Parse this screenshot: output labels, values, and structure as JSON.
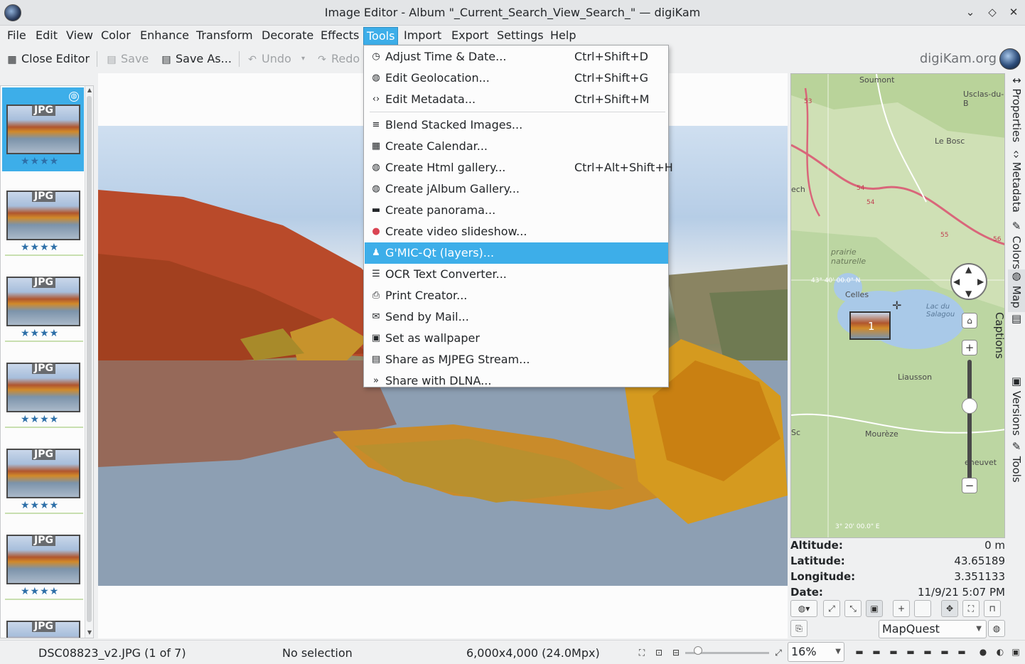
{
  "window": {
    "title": "Image Editor - Album \"_Current_Search_View_Search_\" — digiKam",
    "controls": [
      "⌄",
      "◇",
      "✕"
    ]
  },
  "menubar": [
    "File",
    "Edit",
    "View",
    "Color",
    "Enhance",
    "Transform",
    "Decorate",
    "Effects",
    "Tools",
    "Import",
    "Export",
    "Settings",
    "Help"
  ],
  "toolbar": {
    "close_editor": "Close Editor",
    "save": "Save",
    "save_as": "Save As...",
    "undo": "Undo",
    "redo": "Redo",
    "brand": "digiKam.org"
  },
  "tools_menu": [
    {
      "icon": "clock-icon",
      "glyph": "◷",
      "label": "Adjust Time & Date...",
      "shortcut": "Ctrl+Shift+D"
    },
    {
      "icon": "globe-icon",
      "glyph": "◍",
      "label": "Edit Geolocation...",
      "shortcut": "Ctrl+Shift+G"
    },
    {
      "icon": "code-icon",
      "glyph": "‹›",
      "label": "Edit Metadata...",
      "shortcut": "Ctrl+Shift+M"
    },
    {
      "separator": true
    },
    {
      "icon": "stack-icon",
      "glyph": "≡",
      "label": "Blend Stacked Images...",
      "shortcut": ""
    },
    {
      "icon": "calendar-icon",
      "glyph": "▦",
      "label": "Create Calendar...",
      "shortcut": ""
    },
    {
      "icon": "web-icon",
      "glyph": "◍",
      "label": "Create Html gallery...",
      "shortcut": "Ctrl+Alt+Shift+H"
    },
    {
      "icon": "web-icon",
      "glyph": "◍",
      "label": "Create jAlbum Gallery...",
      "shortcut": ""
    },
    {
      "icon": "panorama-icon",
      "glyph": "▬",
      "label": "Create panorama...",
      "shortcut": ""
    },
    {
      "icon": "record-icon",
      "glyph": "●",
      "label": "Create video slideshow...",
      "shortcut": ""
    },
    {
      "icon": "gmic-icon",
      "glyph": "♟",
      "label": "G'MIC-Qt (layers)...",
      "shortcut": "",
      "highlight": true
    },
    {
      "icon": "text-icon",
      "glyph": "☰",
      "label": "OCR Text Converter...",
      "shortcut": ""
    },
    {
      "icon": "printer-icon",
      "glyph": "⎙",
      "label": "Print Creator...",
      "shortcut": ""
    },
    {
      "icon": "mail-icon",
      "glyph": "✉",
      "label": "Send by Mail...",
      "shortcut": ""
    },
    {
      "icon": "wallpaper-icon",
      "glyph": "▣",
      "label": "Set as wallpaper",
      "shortcut": ""
    },
    {
      "icon": "stream-icon",
      "glyph": "▤",
      "label": "Share as MJPEG Stream...",
      "shortcut": ""
    },
    {
      "icon": "share-icon",
      "glyph": "»",
      "label": "Share with DLNA...",
      "shortcut": ""
    }
  ],
  "thumbnails": [
    {
      "badge": "JPG",
      "stars": "★★★★",
      "selected": true
    },
    {
      "badge": "JPG",
      "stars": "★★★★"
    },
    {
      "badge": "JPG",
      "stars": "★★★★"
    },
    {
      "badge": "JPG",
      "stars": "★★★★"
    },
    {
      "badge": "JPG",
      "stars": "★★★★"
    },
    {
      "badge": "JPG",
      "stars": "★★★★"
    },
    {
      "badge": "JPG",
      "stars": ""
    }
  ],
  "map": {
    "labels": [
      {
        "text": "Soumont"
      },
      {
        "text": "Usclas-du-B"
      },
      {
        "text": "Le Bosc"
      },
      {
        "text": "ech"
      },
      {
        "text": "prairie naturelle"
      },
      {
        "text": "43° 40' 00.0\" N"
      },
      {
        "text": "Celles"
      },
      {
        "text": "Lac du Salagou"
      },
      {
        "text": "Liausson"
      },
      {
        "text": "Mourèze"
      },
      {
        "text": "Sc"
      },
      {
        "text": "eneuvet"
      },
      {
        "text": "3° 20' 00.0\" E"
      },
      {
        "text": "53"
      },
      {
        "text": "54"
      },
      {
        "text": "54"
      },
      {
        "text": "55"
      },
      {
        "text": "56"
      }
    ],
    "marker_count": "1",
    "source": "MapQuest"
  },
  "geo": {
    "altitude_label": "Altitude:",
    "altitude": "0 m",
    "latitude_label": "Latitude:",
    "latitude": "43.65189",
    "longitude_label": "Longitude:",
    "longitude": "3.351133",
    "date_label": "Date:",
    "date": "11/9/21 5:07 PM"
  },
  "right_tabs": [
    "Properties",
    "Metadata",
    "Colors",
    "Map",
    "Captions",
    "Versions",
    "Tools"
  ],
  "status": {
    "filename": "DSC08823_v2.JPG (1 of 7)",
    "selection": "No selection",
    "dimensions": "6,000x4,000 (24.0Mpx)",
    "zoom": "16%",
    "zoom_fraction": 0.16
  },
  "colors": {
    "accent": "#3daee9",
    "rating": "#2d6fa8"
  }
}
